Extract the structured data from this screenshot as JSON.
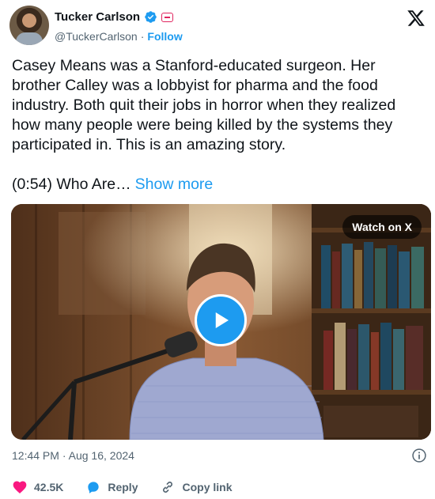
{
  "author": {
    "name": "Tucker Carlson",
    "handle": "@TuckerCarlson",
    "separator": "·",
    "follow_label": "Follow",
    "verified_icon": "verified-badge-icon",
    "affiliation_icon": "affiliation-icon"
  },
  "tweet": {
    "text": "Casey Means was a Stanford-educated surgeon. Her brother Calley was a lobbyist for pharma and the food industry. Both quit their jobs in horror when they realized how many people were being killed by the systems they participated in. This is an amazing story.",
    "video_title": "(0:54) Who Are…",
    "show_more_label": "Show more"
  },
  "media": {
    "watch_label": "Watch on X",
    "play_icon": "play-icon"
  },
  "meta": {
    "time": "12:44 PM",
    "dot": "·",
    "date": "Aug 16, 2024"
  },
  "actions": {
    "like_count": "42.5K",
    "reply_label": "Reply",
    "copy_link_label": "Copy link"
  },
  "colors": {
    "accent": "#1d9bf0",
    "like": "#f91880",
    "text": "#0f1419",
    "muted": "#536471"
  }
}
